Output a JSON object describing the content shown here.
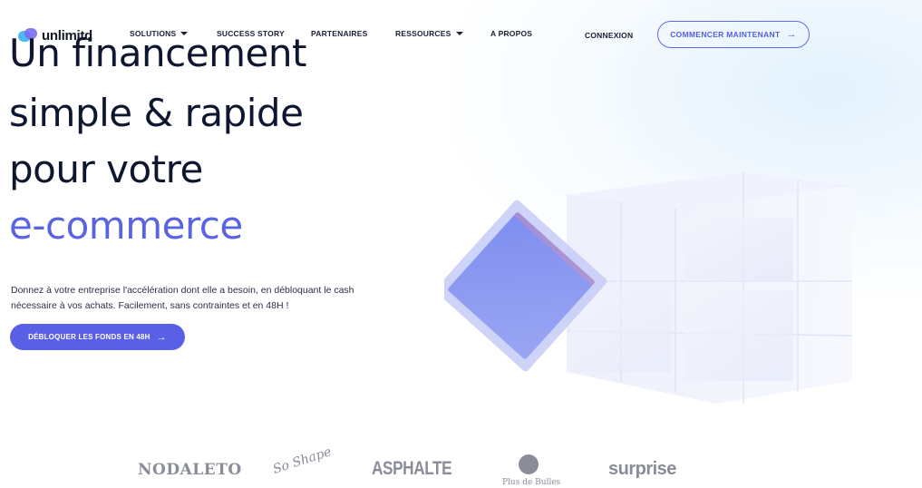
{
  "nav": {
    "logo_text": "unlimitd",
    "items": [
      {
        "label": "SOLUTIONS",
        "dropdown": true
      },
      {
        "label": "SUCCESS STORY",
        "dropdown": false
      },
      {
        "label": "PARTENAIRES",
        "dropdown": false
      },
      {
        "label": "RESSOURCES",
        "dropdown": true
      },
      {
        "label": "A PROPOS",
        "dropdown": false
      }
    ],
    "login_label": "CONNEXION",
    "cta_label": "COMMENCER MAINTENANT",
    "cta_arrow": "→"
  },
  "hero": {
    "headline_lines": [
      "Un financement",
      "simple & rapide",
      "pour votre"
    ],
    "headline_accent": "e-commerce",
    "description_lines": [
      "Donnez à votre entreprise l'accélération dont elle a besoin, en débloquant le cash",
      "nécessaire à vos achats. Facilement, sans contraintes et en 48H !"
    ],
    "button_label": "DÉBLOQUER LES FONDS EN 48H",
    "button_arrow": "→"
  },
  "brands": [
    {
      "name": "NODALETO"
    },
    {
      "name": "So Shape"
    },
    {
      "name": "ASPHALTE"
    },
    {
      "name": "Plus de Bulles"
    },
    {
      "name": "surprise"
    }
  ],
  "colors": {
    "accent": "#5a64e0",
    "dark": "#0f1730",
    "button_bg": "#5a60e6"
  }
}
